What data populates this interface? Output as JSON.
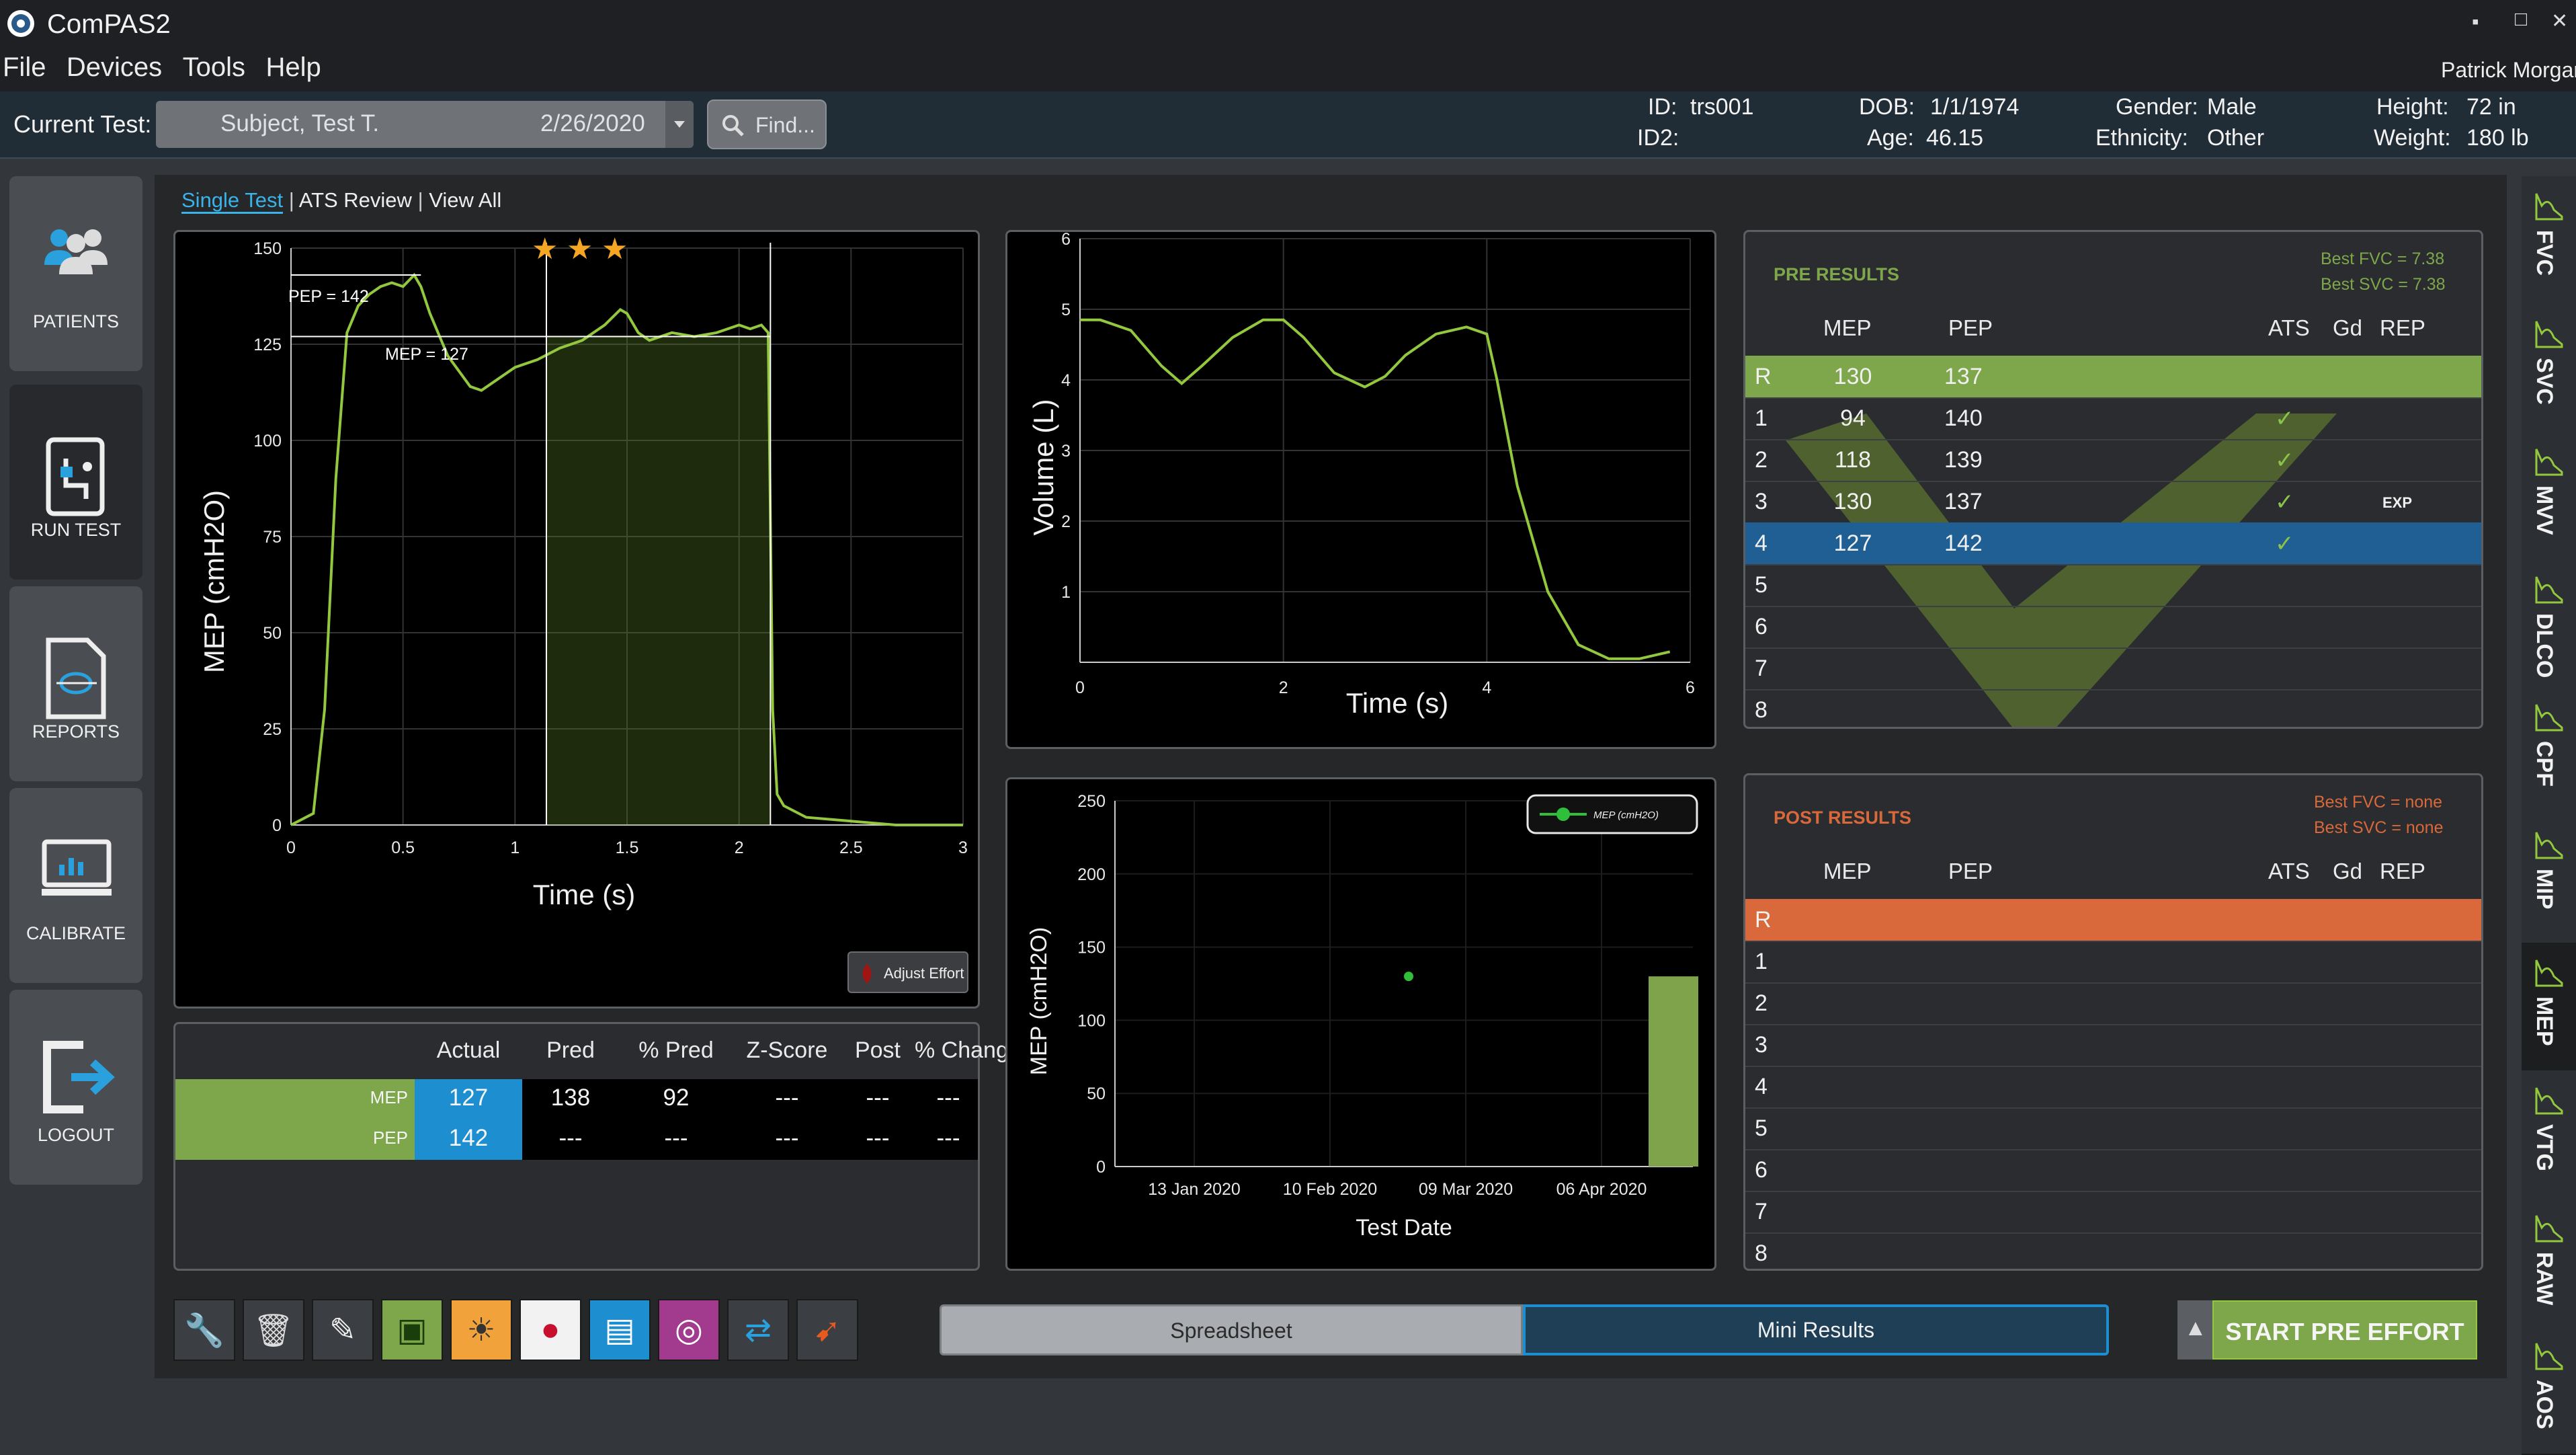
{
  "app": {
    "title": "ComPAS2"
  },
  "window_controls": {
    "minimize": "▪",
    "maximize": "□",
    "close": "✕"
  },
  "menu": {
    "items": [
      "File",
      "Devices",
      "Tools",
      "Help"
    ],
    "user": "Patrick Morgan"
  },
  "current_test": {
    "label": "Current Test:",
    "subject": "Subject, Test T.",
    "date": "2/26/2020",
    "find_placeholder": "Find..."
  },
  "patient": {
    "id_label": "ID:",
    "id": "trs001",
    "id2_label": "ID2:",
    "id2": "",
    "dob_label": "DOB:",
    "dob": "1/1/1974",
    "age_label": "Age:",
    "age": "46.15",
    "gender_label": "Gender:",
    "gender": "Male",
    "ethnicity_label": "Ethnicity:",
    "ethnicity": "Other",
    "height_label": "Height:",
    "height": "72 in",
    "weight_label": "Weight:",
    "weight": "180 lb"
  },
  "nav": {
    "items": [
      {
        "label": "PATIENTS",
        "icon": "patients-icon"
      },
      {
        "label": "RUN TEST",
        "icon": "run-test-icon",
        "active": true
      },
      {
        "label": "REPORTS",
        "icon": "reports-icon"
      },
      {
        "label": "CALIBRATE",
        "icon": "calibrate-icon"
      },
      {
        "label": "LOGOUT",
        "icon": "logout-icon"
      }
    ]
  },
  "view_tabs": {
    "single": "Single Test",
    "ats": "ATS Review",
    "all": "View All",
    "sep": "|"
  },
  "mep_chart": {
    "pep_annot": "PEP = 142",
    "mep_annot": "MEP = 127",
    "stars": [
      "★",
      "★",
      "★"
    ],
    "y_title": "MEP (cmH2O)",
    "x_title": "Time (s)",
    "yticks": [
      "0",
      "25",
      "50",
      "75",
      "100",
      "125",
      "150"
    ],
    "xticks": [
      "0",
      "0.5",
      "1",
      "1.5",
      "2",
      "2.5",
      "3"
    ],
    "adjust_label": "Adjust Effort"
  },
  "chart_data": [
    {
      "type": "line",
      "title": "",
      "xlabel": "Time (s)",
      "ylabel": "MEP (cmH2O)",
      "xlim": [
        0,
        3
      ],
      "ylim": [
        0,
        150
      ],
      "x": [
        0.0,
        0.1,
        0.15,
        0.2,
        0.25,
        0.3,
        0.35,
        0.4,
        0.45,
        0.5,
        0.55,
        0.58,
        0.62,
        0.7,
        0.8,
        0.85,
        0.9,
        1.0,
        1.1,
        1.2,
        1.3,
        1.35,
        1.4,
        1.47,
        1.5,
        1.55,
        1.6,
        1.7,
        1.8,
        1.9,
        2.0,
        2.05,
        2.1,
        2.13,
        2.15,
        2.17,
        2.2,
        2.3,
        2.5,
        2.7,
        3.0
      ],
      "y": [
        0,
        3,
        30,
        90,
        128,
        135,
        138,
        140,
        141,
        140,
        143,
        140,
        133,
        122,
        114,
        113,
        115,
        119,
        121,
        124,
        126,
        128,
        130,
        134,
        133,
        128,
        126,
        128,
        127,
        128,
        130,
        129,
        130,
        128,
        30,
        8,
        5,
        2,
        1,
        0,
        0
      ],
      "annotations": [
        "PEP = 142",
        "MEP = 127"
      ]
    },
    {
      "type": "line",
      "xlabel": "Time (s)",
      "ylabel": "Volume (L)",
      "xlim": [
        0,
        6
      ],
      "ylim": [
        0,
        6
      ],
      "x": [
        0,
        0.2,
        0.5,
        0.8,
        1.0,
        1.2,
        1.5,
        1.8,
        2.0,
        2.2,
        2.5,
        2.8,
        3.0,
        3.2,
        3.5,
        3.8,
        4.0,
        4.1,
        4.3,
        4.6,
        4.9,
        5.2,
        5.5,
        5.8
      ],
      "y": [
        4.85,
        4.85,
        4.7,
        4.2,
        3.95,
        4.2,
        4.6,
        4.85,
        4.85,
        4.6,
        4.1,
        3.9,
        4.05,
        4.35,
        4.65,
        4.75,
        4.65,
        4.0,
        2.5,
        1.0,
        0.25,
        0.05,
        0.05,
        0.15
      ]
    },
    {
      "type": "scatter",
      "xlabel": "Test Date",
      "ylabel": "MEP (cmH2O)",
      "ylim": [
        0,
        250
      ],
      "xticks": [
        "13 Jan 2020",
        "10 Feb 2020",
        "09 Mar 2020",
        "06 Apr 2020"
      ],
      "series": [
        {
          "name": "MEP (cmH2O)",
          "points": [
            {
              "x": "2020-02-26",
              "y": 130
            }
          ]
        }
      ],
      "bar": {
        "value": 130,
        "color": "#7fa34a"
      }
    }
  ],
  "vol_chart": {
    "y_title": "Volume (L)",
    "x_title": "Time (s)",
    "yticks": [
      "1",
      "2",
      "3",
      "4",
      "5",
      "6"
    ],
    "xticks": [
      "0",
      "2",
      "4",
      "6"
    ]
  },
  "trend_chart": {
    "y_title": "MEP (cmH2O)",
    "x_title": "Test Date",
    "yticks": [
      "0",
      "50",
      "100",
      "150",
      "200",
      "250"
    ],
    "xticks": [
      "13 Jan 2020",
      "10 Feb 2020",
      "09 Mar 2020",
      "06 Apr 2020"
    ],
    "legend": "MEP (cmH2O)"
  },
  "summary": {
    "headers": [
      "Actual",
      "Pred",
      "% Pred",
      "Z-Score",
      "Post",
      "% Change"
    ],
    "rows": [
      {
        "label": "MEP",
        "values": [
          "127",
          "138",
          "92",
          "---",
          "---",
          "---"
        ]
      },
      {
        "label": "PEP",
        "values": [
          "142",
          "---",
          "---",
          "---",
          "---",
          "---"
        ]
      }
    ]
  },
  "pre_results": {
    "title": "PRE RESULTS",
    "best_fvc": "Best FVC = 7.38",
    "best_svc": "Best SVC = 7.38",
    "headers": [
      "MEP",
      "PEP",
      "ATS",
      "Gd",
      "REP"
    ],
    "rows": [
      {
        "n": "R",
        "mep": "130",
        "pep": "137",
        "ats": ""
      },
      {
        "n": "1",
        "mep": "94",
        "pep": "140",
        "ats": "✓"
      },
      {
        "n": "2",
        "mep": "118",
        "pep": "139",
        "ats": "✓"
      },
      {
        "n": "3",
        "mep": "130",
        "pep": "137",
        "ats": "✓",
        "rep": "EXP"
      },
      {
        "n": "4",
        "mep": "127",
        "pep": "142",
        "ats": "✓"
      },
      {
        "n": "5",
        "mep": "",
        "pep": "",
        "ats": ""
      },
      {
        "n": "6",
        "mep": "",
        "pep": "",
        "ats": ""
      },
      {
        "n": "7",
        "mep": "",
        "pep": "",
        "ats": ""
      },
      {
        "n": "8",
        "mep": "",
        "pep": "",
        "ats": ""
      }
    ]
  },
  "post_results": {
    "title": "POST RESULTS",
    "best_fvc": "Best FVC = none",
    "best_svc": "Best SVC = none",
    "headers": [
      "MEP",
      "PEP",
      "ATS",
      "Gd",
      "REP"
    ],
    "rows": [
      "R",
      "1",
      "2",
      "3",
      "4",
      "5",
      "6",
      "7",
      "8"
    ]
  },
  "toolbar": {
    "icons": [
      "wrench-icon",
      "trash-icon",
      "edit-icon",
      "patient-folder-icon",
      "weather-icon",
      "blood-drop-icon",
      "monitor-icon",
      "rotate-icon",
      "syringe-icon",
      "carrot-icon"
    ]
  },
  "bottom": {
    "spreadsheet": "Spreadsheet",
    "mini": "Mini Results",
    "start": "START PRE EFFORT",
    "up": "▲"
  },
  "side_tabs": [
    {
      "label": "FVC"
    },
    {
      "label": "SVC"
    },
    {
      "label": "MVV"
    },
    {
      "label": "DLCO"
    },
    {
      "label": "CPF"
    },
    {
      "label": "MIP"
    },
    {
      "label": "MEP",
      "active": true
    },
    {
      "label": "VTG"
    },
    {
      "label": "RAW"
    },
    {
      "label": "AOS"
    }
  ],
  "colors": {
    "accent_green": "#7ea64a",
    "accent_blue": "#1d8fd1",
    "accent_orange": "#d9683a",
    "curve": "#93c83e",
    "sel_blue": "#1f5f94"
  }
}
